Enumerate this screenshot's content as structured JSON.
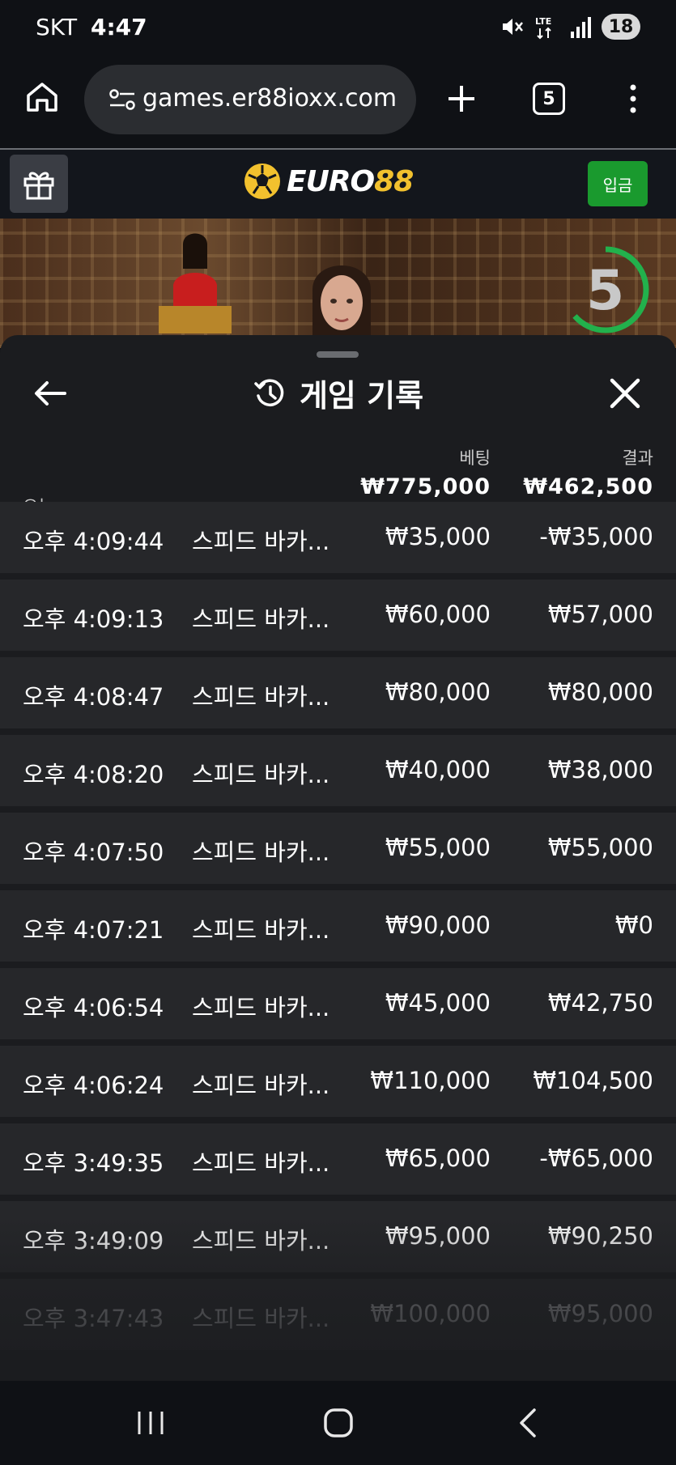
{
  "status_bar": {
    "carrier": "SKT",
    "time": "4:47",
    "network": "LTE",
    "battery": "18"
  },
  "browser": {
    "url": "games.er88ioxx.com",
    "tab_count": "5"
  },
  "site_header": {
    "logo_text_main": "EURO",
    "logo_text_accent": "88",
    "deposit_label": "입금"
  },
  "video": {
    "countdown": "5"
  },
  "sheet": {
    "title": "게임 기록",
    "summary": {
      "date_label": "오늘",
      "bet_label": "베팅",
      "bet_total": "₩775,000",
      "result_label": "결과",
      "result_total": "₩462,500"
    },
    "rows": [
      {
        "time": "오후 4:09:44",
        "game": "스피드 바카...",
        "bet": "₩35,000",
        "result": "-₩35,000"
      },
      {
        "time": "오후 4:09:13",
        "game": "스피드 바카...",
        "bet": "₩60,000",
        "result": "₩57,000"
      },
      {
        "time": "오후 4:08:47",
        "game": "스피드 바카...",
        "bet": "₩80,000",
        "result": "₩80,000"
      },
      {
        "time": "오후 4:08:20",
        "game": "스피드 바카...",
        "bet": "₩40,000",
        "result": "₩38,000"
      },
      {
        "time": "오후 4:07:50",
        "game": "스피드 바카...",
        "bet": "₩55,000",
        "result": "₩55,000"
      },
      {
        "time": "오후 4:07:21",
        "game": "스피드 바카...",
        "bet": "₩90,000",
        "result": "₩0"
      },
      {
        "time": "오후 4:06:54",
        "game": "스피드 바카...",
        "bet": "₩45,000",
        "result": "₩42,750"
      },
      {
        "time": "오후 4:06:24",
        "game": "스피드 바카...",
        "bet": "₩110,000",
        "result": "₩104,500"
      },
      {
        "time": "오후 3:49:35",
        "game": "스피드 바카...",
        "bet": "₩65,000",
        "result": "-₩65,000"
      },
      {
        "time": "오후 3:49:09",
        "game": "스피드 바카...",
        "bet": "₩95,000",
        "result": "₩90,250"
      },
      {
        "time": "오후 3:47:43",
        "game": "스피드 바카...",
        "bet": "₩100,000",
        "result": "₩95,000"
      }
    ]
  },
  "colors": {
    "accent_gold": "#f2c12e",
    "deposit_green": "#1a9a2e",
    "countdown_green": "#22b14c",
    "sheet_bg": "#1b1c1f",
    "row_bg": "#26272a"
  }
}
